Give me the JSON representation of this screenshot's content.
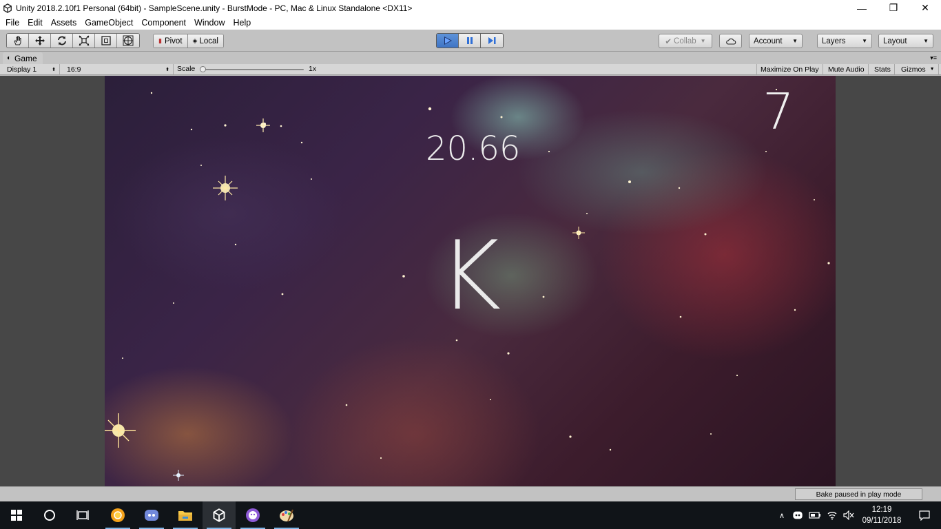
{
  "window": {
    "title": "Unity 2018.2.10f1 Personal (64bit) - SampleScene.unity - BurstMode - PC, Mac & Linux Standalone <DX11>",
    "controls": [
      "minimize",
      "restore",
      "close"
    ]
  },
  "menu": [
    "File",
    "Edit",
    "Assets",
    "GameObject",
    "Component",
    "Window",
    "Help"
  ],
  "toolbar": {
    "tools": [
      "hand-tool-icon",
      "move-tool-icon",
      "rotate-tool-icon",
      "scale-tool-icon",
      "rect-tool-icon",
      "transform-tool-icon"
    ],
    "pivot": "Pivot",
    "local": "Local",
    "play_state": "playing",
    "collab": "Collab",
    "account": "Account",
    "layers": "Layers",
    "layout": "Layout"
  },
  "game_tab": {
    "label": "Game",
    "display": "Display 1",
    "aspect": "16:9",
    "scale_label": "Scale",
    "scale_value": "1x",
    "maximize": "Maximize On Play",
    "mute": "Mute Audio",
    "stats": "Stats",
    "gizmos": "Gizmos"
  },
  "game": {
    "timer": "20.66",
    "letter": "K",
    "count": "7"
  },
  "status": {
    "message": "Bake paused in play mode"
  },
  "taskbar": {
    "apps": [
      "start-icon",
      "cortana-icon",
      "task-view-icon",
      "chrome-canary-icon",
      "discord-icon",
      "file-explorer-icon",
      "unity-icon",
      "gitkraken-icon",
      "paint-icon"
    ],
    "time": "12:19",
    "date": "09/11/2018"
  },
  "colors": {
    "play_active": "#4a82d0",
    "editor_bg": "#c2c2c2",
    "taskbar": "#101418"
  }
}
